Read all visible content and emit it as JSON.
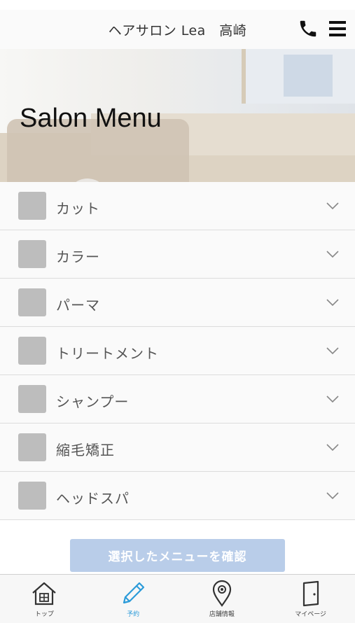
{
  "header": {
    "title": "ヘアサロン Lea　高崎",
    "phone_icon": "phone-icon",
    "menu_icon": "hamburger-menu-icon"
  },
  "hero": {
    "headline": "Salon Menu"
  },
  "menu_items": [
    {
      "label": "カット",
      "checked": false
    },
    {
      "label": "カラー",
      "checked": false
    },
    {
      "label": "パーマ",
      "checked": false
    },
    {
      "label": "トリートメント",
      "checked": false
    },
    {
      "label": "シャンプー",
      "checked": false
    },
    {
      "label": "縮毛矯正",
      "checked": false
    },
    {
      "label": "ヘッドスパ",
      "checked": false
    }
  ],
  "confirm_button": {
    "label": "選択したメニューを確認"
  },
  "tabbar": {
    "items": [
      {
        "label": "トップ",
        "icon": "home-icon",
        "active": false
      },
      {
        "label": "予約",
        "icon": "pencil-icon",
        "active": true
      },
      {
        "label": "店舗情報",
        "icon": "map-pin-icon",
        "active": false
      },
      {
        "label": "マイページ",
        "icon": "door-icon",
        "active": false
      }
    ]
  },
  "colors": {
    "accent": "#2b9bd9",
    "button_disabled": "#b9cde9",
    "checkbox": "#bdbdbd"
  }
}
